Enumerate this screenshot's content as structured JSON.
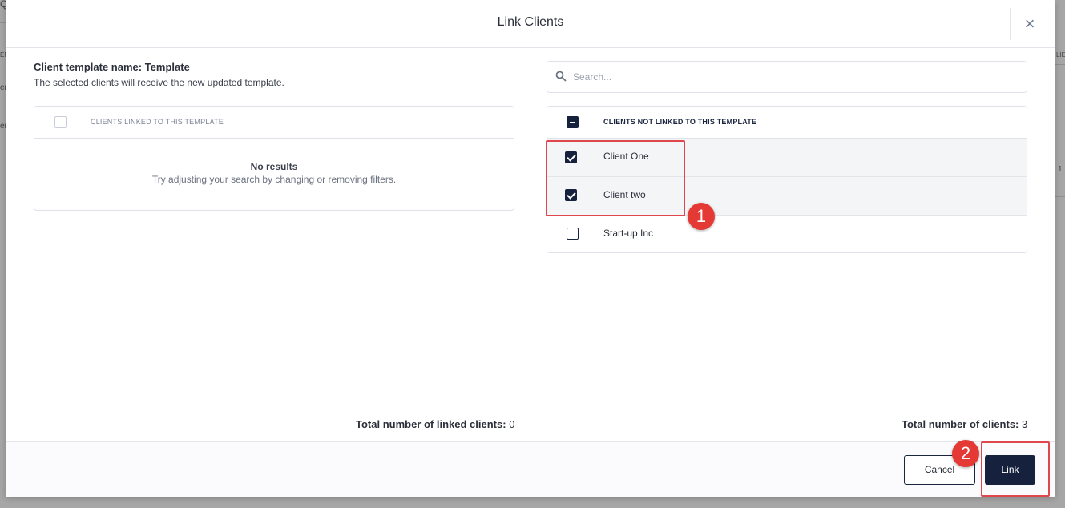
{
  "background": {
    "fragments": [
      "Q",
      "EN",
      "er",
      "er",
      "LIE",
      "1"
    ]
  },
  "modal": {
    "title": "Link Clients",
    "close_icon": "close-icon"
  },
  "left_pane": {
    "template_name": "Client template name: Template",
    "description": "The selected clients will receive the new updated template.",
    "table_header": "CLIENTS LINKED TO THIS TEMPLATE",
    "empty_title": "No results",
    "empty_hint": "Try adjusting your search by changing or removing filters.",
    "total_label": "Total number of linked clients:",
    "total_value": "0"
  },
  "right_pane": {
    "search_placeholder": "Search...",
    "table_header": "CLIENTS NOT LINKED TO THIS TEMPLATE",
    "rows": [
      {
        "label": "Client One",
        "checked": true
      },
      {
        "label": "Client two",
        "checked": true
      },
      {
        "label": "Start-up Inc",
        "checked": false
      }
    ],
    "total_label": "Total number of clients:",
    "total_value": "3"
  },
  "footer": {
    "cancel_label": "Cancel",
    "link_label": "Link"
  },
  "annotations": {
    "badge_1": "1",
    "badge_2": "2",
    "color": "#e53935"
  }
}
